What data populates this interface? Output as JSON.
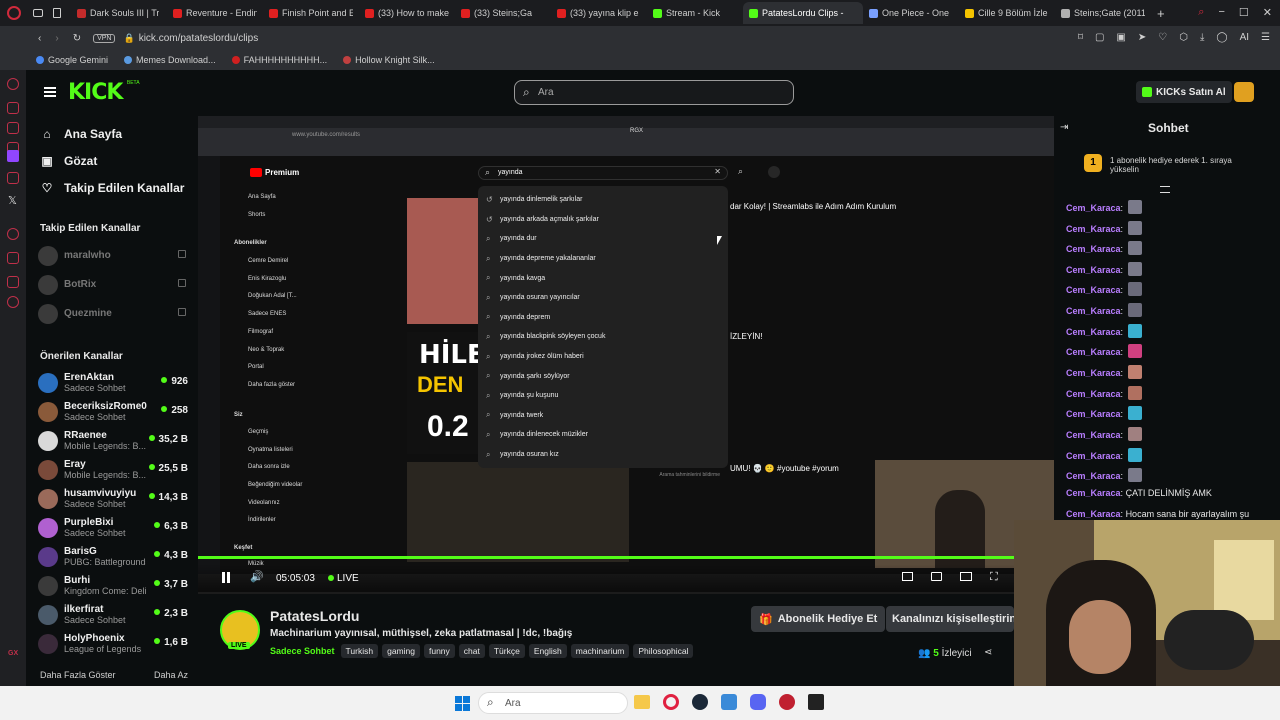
{
  "browser": {
    "tabs": [
      {
        "label": "Dark Souls III | Tr",
        "color": "#c42b2b"
      },
      {
        "label": "Reventure - Endin",
        "color": "#e02020"
      },
      {
        "label": "Finish Point and E",
        "color": "#e02020"
      },
      {
        "label": "(33) How to make",
        "color": "#e02020"
      },
      {
        "label": "(33) Steins;Ga",
        "color": "#e02020"
      },
      {
        "label": "(33) yayına klip e",
        "color": "#e02020"
      },
      {
        "label": "Stream - Kick",
        "color": "#53fc18"
      },
      {
        "label": "PatatesLordu Clips -",
        "color": "#53fc18"
      },
      {
        "label": "One Piece - One",
        "color": "#7aa0ff"
      },
      {
        "label": "Cille 9 Bölüm İzle",
        "color": "#f5c400"
      },
      {
        "label": "Steins;Gate (2011",
        "color": "#b0b0b0"
      }
    ],
    "vpn_label": "VPN",
    "url": "kick.com/patateslordu/clips",
    "bookmarks": [
      "Google Gemini",
      "Memes Download...",
      "FAHHHHHHHHHH...",
      "Hollow Knight Silk..."
    ],
    "ai_label": "AI"
  },
  "kick": {
    "logo": "KICK",
    "logo_badge": "BETA",
    "search_placeholder": "Ara",
    "buy_kicks_label": "KICKs Satın Al",
    "nav": [
      {
        "label": "Ana Sayfa",
        "icon": "home-icon"
      },
      {
        "label": "Gözat",
        "icon": "browse-icon"
      },
      {
        "label": "Takip Edilen Kanallar",
        "icon": "heart-icon"
      }
    ],
    "followed_heading": "Takip Edilen Kanallar",
    "followed": [
      {
        "name": "maralwho"
      },
      {
        "name": "BotRix"
      },
      {
        "name": "Quezmine"
      }
    ],
    "recommended_heading": "Önerilen Kanallar",
    "recommended": [
      {
        "name": "ErenAktan",
        "sub": "Sadece Sohbet",
        "viewers": "926",
        "color": "#2a6fbf"
      },
      {
        "name": "BeceriksizRome0",
        "sub": "Sadece Sohbet",
        "viewers": "258",
        "color": "#8a5a3a"
      },
      {
        "name": "RRaenee",
        "sub": "Mobile Legends: B...",
        "viewers": "35,2 B",
        "color": "#d9d9d9"
      },
      {
        "name": "Eray",
        "sub": "Mobile Legends: B...",
        "viewers": "25,5 B",
        "color": "#7a4a3a"
      },
      {
        "name": "husamvivuyiyu",
        "sub": "Sadece Sohbet",
        "viewers": "14,3 B",
        "color": "#9a6a5a"
      },
      {
        "name": "PurpleBixi",
        "sub": "Sadece Sohbet",
        "viewers": "6,3 B",
        "color": "#b060d0"
      },
      {
        "name": "BarisG",
        "sub": "PUBG: Battlegrounds",
        "viewers": "4,3 B",
        "color": "#5a3a8a"
      },
      {
        "name": "Burhi",
        "sub": "Kingdom Come: Deli...",
        "viewers": "3,7 B",
        "color": "#3a3a3a"
      },
      {
        "name": "ilkerfirat",
        "sub": "Sadece Sohbet",
        "viewers": "2,3 B",
        "color": "#4a5a6a"
      },
      {
        "name": "HolyPhoenix",
        "sub": "League of Legends",
        "viewers": "1,6 B",
        "color": "#3a2a3a"
      }
    ],
    "show_more": "Daha Fazla Göster",
    "show_less": "Daha Az",
    "chat": {
      "title": "Sohbet",
      "gift_badge": "1",
      "gift_text": "1 abonelik hediye ederek 1. sıraya yükselin",
      "messages": [
        {
          "user": "Cem_Karaca",
          "text": "",
          "emote": "#7a7a8a"
        },
        {
          "user": "Cem_Karaca",
          "text": "",
          "emote": "#7a7a8a"
        },
        {
          "user": "Cem_Karaca",
          "text": "",
          "emote": "#7a7a8a"
        },
        {
          "user": "Cem_Karaca",
          "text": "",
          "emote": "#7a7a8a"
        },
        {
          "user": "Cem_Karaca",
          "text": "",
          "emote": "#6a6a7a"
        },
        {
          "user": "Cem_Karaca",
          "text": "",
          "emote": "#6a6a7a"
        },
        {
          "user": "Cem_Karaca",
          "text": "",
          "emote": "#3ab0d0"
        },
        {
          "user": "Cem_Karaca",
          "text": "",
          "emote": "#d04080"
        },
        {
          "user": "Cem_Karaca",
          "text": "",
          "emote": "#c08070"
        },
        {
          "user": "Cem_Karaca",
          "text": "",
          "emote": "#b07060"
        },
        {
          "user": "Cem_Karaca",
          "text": "",
          "emote": "#3ab0d0"
        },
        {
          "user": "Cem_Karaca",
          "text": "",
          "emote": "#a08080"
        },
        {
          "user": "Cem_Karaca",
          "text": "",
          "emote": "#3ab0d0"
        },
        {
          "user": "Cem_Karaca",
          "text": "",
          "emote": "#7a7a8a"
        },
        {
          "user": "Cem_Karaca",
          "text": "ÇATI DELİNMİŞ AMK",
          "emote": ""
        },
        {
          "user": "Cem_Karaca",
          "text": "Hocam sana bir ayarlayalım şu",
          "emote": ""
        }
      ]
    },
    "player": {
      "time": "05:05:03",
      "live": "LIVE"
    },
    "channel": {
      "name": "PatatesLordu",
      "title": "Machinarium yayınısal, müthişsel, zeka patlatmasal | !dc, !bağış",
      "category": "Sadece Sohbet",
      "tags": [
        "Turkish",
        "gaming",
        "funny",
        "chat",
        "Türkçe",
        "English",
        "machinarium",
        "Philosophical"
      ],
      "gift_button": "Abonelik Hediye Et",
      "customize_button": "Kanalınızı kişiselleştirin",
      "viewers": "5",
      "viewers_label": "İzleyici",
      "live_badge": "LIVE"
    }
  },
  "stream_screen": {
    "youtube_logo": "Premium",
    "search_text": "yayında",
    "suggestions": [
      "yayında dinlemelik şarkılar",
      "yayında arkada açmalık şarkılar",
      "yayında dur",
      "yayında depreme yakalananlar",
      "yayında kavga",
      "yayında osuran yayıncılar",
      "yayında deprem",
      "yayında blackpink söyleyen çocuk",
      "yayında jrokez ölüm haberi",
      "yayında şarkı söylüyor",
      "yayında şu kuşunu",
      "yayında twerk",
      "yayında dinlenecek müzikler",
      "yayında osuran kız"
    ],
    "yt_nav": [
      "Ana Sayfa",
      "Shorts"
    ],
    "subs_heading": "Abonelikler",
    "subs": [
      "Cemre Demirel",
      "Enis Kirazoglu",
      "Doğukan Adal [T...",
      "Sadece ENES",
      "Filmograf",
      "Neo & Toprak",
      "Portal"
    ],
    "show_more": "Daha fazla göster",
    "you_heading": "Siz",
    "you_items": [
      "Geçmiş",
      "Oynatma listeleri",
      "Daha sonra izle",
      "Beğendiğim videolar",
      "Videolarınız",
      "İndirilenler"
    ],
    "explore_heading": "Keşfet",
    "music": "Müzik",
    "result1_title": "dar Kolay! | Streamlabs ile Adım Adım Kurulum",
    "result2_title": "İZLEYİN!",
    "result3_title": "UMU! 💀 🙂 #youtube #yorum",
    "thumb_text1": "HİLE",
    "thumb_text2": "DEN",
    "thumb_text3": "0.2",
    "url_small": "www.youtube.com/results",
    "rgx_label": "RGX",
    "report_text": "Arama tahminlerini bildirme"
  },
  "taskbar": {
    "search_label": "Ara"
  }
}
